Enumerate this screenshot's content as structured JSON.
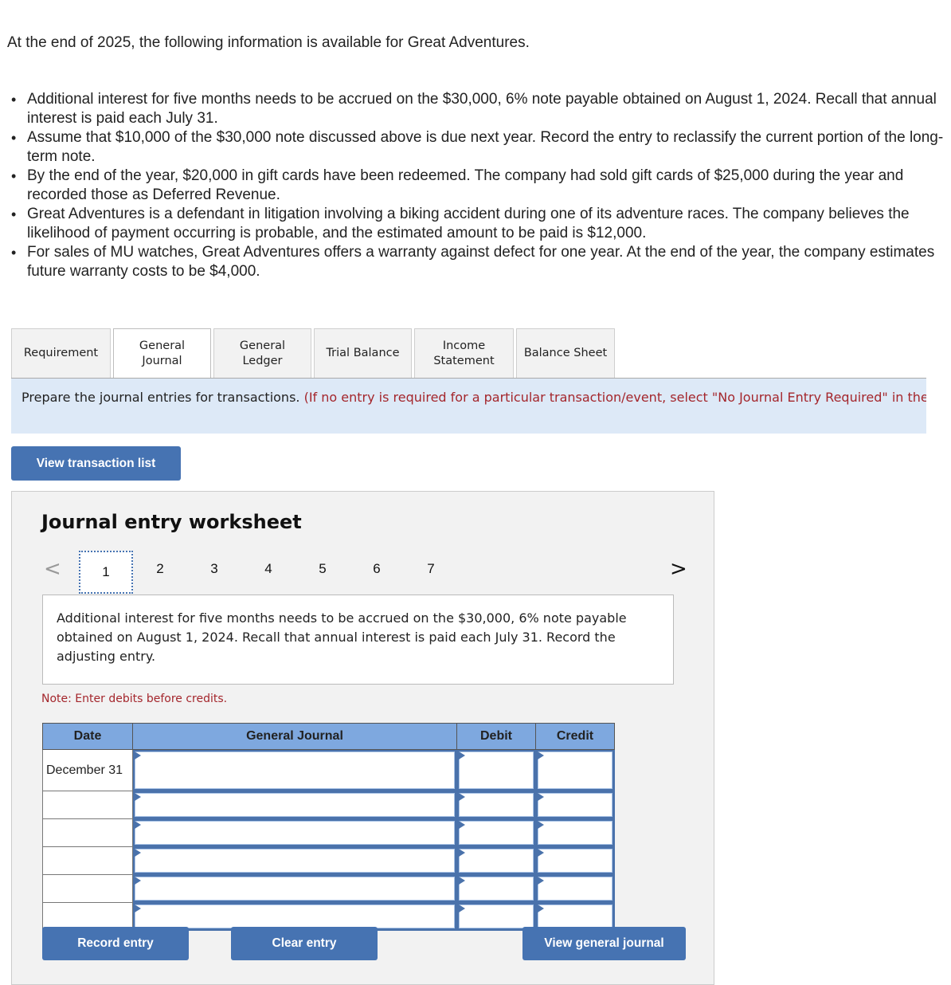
{
  "intro": "At the end of 2025, the following information is available for Great Adventures.",
  "bullets": [
    "Additional interest for five months needs to be accrued on the $30,000, 6% note payable obtained on August 1, 2024. Recall that annual interest is paid each July 31.",
    "Assume that $10,000 of the $30,000 note discussed above is due next year. Record the entry to reclassify the current portion of the long-term note.",
    "By the end of the year, $20,000 in gift cards have been redeemed. The company had sold gift cards of $25,000 during the year and recorded those as Deferred Revenue.",
    "Great Adventures is a defendant in litigation involving a biking accident during one of its adventure races. The company believes the likelihood of payment occurring is probable, and the estimated amount to be paid is $12,000.",
    "For sales of MU watches, Great Adventures offers a warranty against defect for one year. At the end of the year, the company estimates future warranty costs to be $4,000."
  ],
  "tabs": [
    {
      "label_1": "Requirement",
      "label_2": ""
    },
    {
      "label_1": "General",
      "label_2": "Journal",
      "active": true
    },
    {
      "label_1": "General",
      "label_2": "Ledger"
    },
    {
      "label_1": "Trial Balance",
      "label_2": ""
    },
    {
      "label_1": "Income",
      "label_2": "Statement"
    },
    {
      "label_1": "Balance Sheet",
      "label_2": ""
    }
  ],
  "instructions": {
    "main": "Prepare the journal entries for transactions. ",
    "note": "(If no entry is required for a particular transaction/event, select \"No Journal Entry Required\" in the first account field.)"
  },
  "buttons": {
    "view_transaction_list": "View transaction list",
    "record_entry": "Record entry",
    "clear_entry": "Clear entry",
    "view_general_journal": "View general journal"
  },
  "worksheet": {
    "title": "Journal entry worksheet",
    "pages": [
      "1",
      "2",
      "3",
      "4",
      "5",
      "6",
      "7"
    ],
    "current_page": "1",
    "prev_icon": "<",
    "next_icon": ">",
    "prompt": "Additional interest for five months needs to be accrued on the $30,000, 6% note payable obtained on August 1, 2024. Recall that annual interest is paid each July 31. Record the adjusting entry.",
    "note": "Note: Enter debits before credits."
  },
  "journal_table": {
    "headers": {
      "date": "Date",
      "account": "General Journal",
      "debit": "Debit",
      "credit": "Credit"
    },
    "rows": [
      {
        "date": "December 31",
        "account": "",
        "debit": "",
        "credit": ""
      },
      {
        "date": "",
        "account": "",
        "debit": "",
        "credit": ""
      },
      {
        "date": "",
        "account": "",
        "debit": "",
        "credit": ""
      },
      {
        "date": "",
        "account": "",
        "debit": "",
        "credit": ""
      },
      {
        "date": "",
        "account": "",
        "debit": "",
        "credit": ""
      },
      {
        "date": "",
        "account": "",
        "debit": "",
        "credit": ""
      }
    ]
  },
  "colors": {
    "button_blue": "#4673b2",
    "header_blue": "#7ea8df",
    "instruction_bg": "#dde9f7",
    "note_red": "#a4262c",
    "panel_gray": "#f2f2f2"
  }
}
